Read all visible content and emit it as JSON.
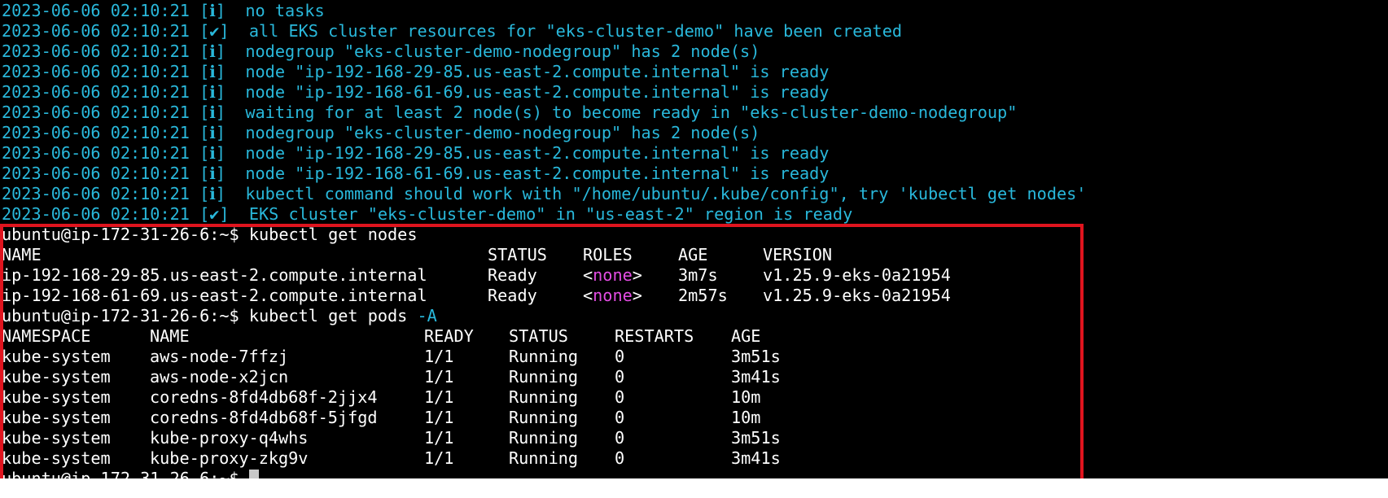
{
  "colors": {
    "log_text": "#29b8db",
    "none_text": "#e34ce3",
    "highlight_border": "#e0141e",
    "background": "#000000"
  },
  "log_lines": [
    "2023-06-06 02:10:21 [ℹ]  no tasks",
    "2023-06-06 02:10:21 [✔]  all EKS cluster resources for \"eks-cluster-demo\" have been created",
    "2023-06-06 02:10:21 [ℹ]  nodegroup \"eks-cluster-demo-nodegroup\" has 2 node(s)",
    "2023-06-06 02:10:21 [ℹ]  node \"ip-192-168-29-85.us-east-2.compute.internal\" is ready",
    "2023-06-06 02:10:21 [ℹ]  node \"ip-192-168-61-69.us-east-2.compute.internal\" is ready",
    "2023-06-06 02:10:21 [ℹ]  waiting for at least 2 node(s) to become ready in \"eks-cluster-demo-nodegroup\"",
    "2023-06-06 02:10:21 [ℹ]  nodegroup \"eks-cluster-demo-nodegroup\" has 2 node(s)",
    "2023-06-06 02:10:21 [ℹ]  node \"ip-192-168-29-85.us-east-2.compute.internal\" is ready",
    "2023-06-06 02:10:21 [ℹ]  node \"ip-192-168-61-69.us-east-2.compute.internal\" is ready",
    "2023-06-06 02:10:21 [ℹ]  kubectl command should work with \"/home/ubuntu/.kube/config\", try 'kubectl get nodes'",
    "2023-06-06 02:10:21 [✔]  EKS cluster \"eks-cluster-demo\" in \"us-east-2\" region is ready"
  ],
  "prompt": "ubuntu@ip-172-31-26-6:~$",
  "cmd1": "kubectl get nodes",
  "cmd2_base": "kubectl get pods",
  "cmd2_flag": "-A",
  "nodes": {
    "headers": [
      "NAME",
      "STATUS",
      "ROLES",
      "AGE",
      "VERSION"
    ],
    "rows": [
      {
        "name": "ip-192-168-29-85.us-east-2.compute.internal",
        "status": "Ready",
        "roles": "none",
        "age": "3m7s",
        "version": "v1.25.9-eks-0a21954"
      },
      {
        "name": "ip-192-168-61-69.us-east-2.compute.internal",
        "status": "Ready",
        "roles": "none",
        "age": "2m57s",
        "version": "v1.25.9-eks-0a21954"
      }
    ]
  },
  "pods": {
    "headers": [
      "NAMESPACE",
      "NAME",
      "READY",
      "STATUS",
      "RESTARTS",
      "AGE"
    ],
    "rows": [
      {
        "namespace": "kube-system",
        "name": "aws-node-7ffzj",
        "ready": "1/1",
        "status": "Running",
        "restarts": "0",
        "age": "3m51s"
      },
      {
        "namespace": "kube-system",
        "name": "aws-node-x2jcn",
        "ready": "1/1",
        "status": "Running",
        "restarts": "0",
        "age": "3m41s"
      },
      {
        "namespace": "kube-system",
        "name": "coredns-8fd4db68f-2jjx4",
        "ready": "1/1",
        "status": "Running",
        "restarts": "0",
        "age": "10m"
      },
      {
        "namespace": "kube-system",
        "name": "coredns-8fd4db68f-5jfgd",
        "ready": "1/1",
        "status": "Running",
        "restarts": "0",
        "age": "10m"
      },
      {
        "namespace": "kube-system",
        "name": "kube-proxy-q4whs",
        "ready": "1/1",
        "status": "Running",
        "restarts": "0",
        "age": "3m51s"
      },
      {
        "namespace": "kube-system",
        "name": "kube-proxy-zkg9v",
        "ready": "1/1",
        "status": "Running",
        "restarts": "0",
        "age": "3m41s"
      }
    ]
  }
}
